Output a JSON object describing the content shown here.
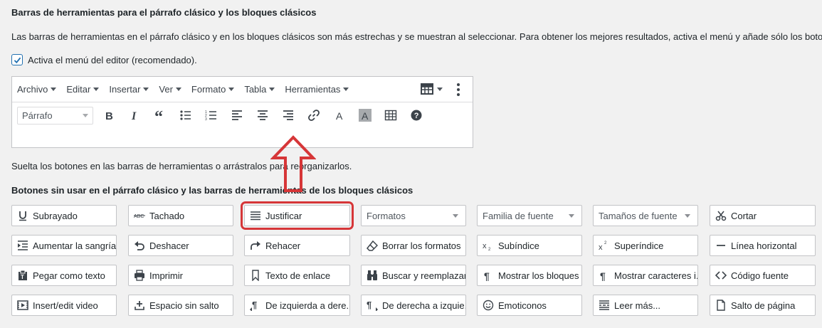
{
  "section": {
    "heading": "Barras de herramientas para el párrafo clásico y los bloques clásicos",
    "description": "Las barras de herramientas en el párrafo clásico y en los bloques clásicos son más estrechas y se muestran al seleccionar. Para obtener los mejores resultados, activa el menú y añade sólo los botones e",
    "checkbox_label": "Activa el menú del editor (recomendado).",
    "checkbox_checked": true
  },
  "editor": {
    "menu": [
      "Archivo",
      "Editar",
      "Insertar",
      "Ver",
      "Formato",
      "Tabla",
      "Herramientas"
    ],
    "format_select": "Párrafo",
    "toolbar_icons": [
      "bold-icon",
      "italic-icon",
      "blockquote-icon",
      "bullet-list-icon",
      "numbered-list-icon",
      "align-left-icon",
      "align-center-icon",
      "align-right-icon",
      "link-icon",
      "text-color-icon",
      "background-color-icon",
      "table-icon",
      "help-icon"
    ]
  },
  "drop_help": "Suelta los botones en las barras de herramientas o arrástralos para reorganizarlos.",
  "unused_heading": "Botones sin usar en el párrafo clásico y las barras de herramientas de los bloques clásicos",
  "buttons": [
    {
      "label": "Subrayado",
      "icon": "underline-icon"
    },
    {
      "label": "Tachado",
      "icon": "strikethrough-icon"
    },
    {
      "label": "Justificar",
      "icon": "justify-icon"
    },
    {
      "label": "Formatos",
      "icon": "select"
    },
    {
      "label": "Familia de fuente",
      "icon": "select"
    },
    {
      "label": "Tamaños de fuente",
      "icon": "select"
    },
    {
      "label": "Cortar",
      "icon": "scissors-icon"
    },
    {
      "label": "Aumentar la sangría",
      "icon": "indent-icon"
    },
    {
      "label": "Deshacer",
      "icon": "undo-icon"
    },
    {
      "label": "Rehacer",
      "icon": "redo-icon"
    },
    {
      "label": "Borrar los formatos",
      "icon": "eraser-icon"
    },
    {
      "label": "Subíndice",
      "icon": "subscript-icon"
    },
    {
      "label": "Superíndice",
      "icon": "superscript-icon"
    },
    {
      "label": "Línea horizontal",
      "icon": "horizontal-line-icon"
    },
    {
      "label": "Pegar como texto",
      "icon": "paste-text-icon"
    },
    {
      "label": "Imprimir",
      "icon": "print-icon"
    },
    {
      "label": "Texto de enlace",
      "icon": "bookmark-icon"
    },
    {
      "label": "Buscar y reemplazar",
      "icon": "binoculars-icon"
    },
    {
      "label": "Mostrar los bloques",
      "icon": "pilcrow-icon"
    },
    {
      "label": "Mostrar caracteres i...",
      "icon": "pilcrow-icon"
    },
    {
      "label": "Código fuente",
      "icon": "code-icon"
    },
    {
      "label": "Insert/edit video",
      "icon": "video-icon"
    },
    {
      "label": "Espacio sin salto",
      "icon": "nbsp-icon"
    },
    {
      "label": "De izquierda a dere...",
      "icon": "ltr-icon"
    },
    {
      "label": "De derecha a izquie...",
      "icon": "rtl-icon"
    },
    {
      "label": "Emoticonos",
      "icon": "smiley-icon"
    },
    {
      "label": "Leer más...",
      "icon": "read-more-icon"
    },
    {
      "label": "Salto de página",
      "icon": "page-break-icon"
    }
  ],
  "highlight_color": "#d63638",
  "accent_color": "#2271b1"
}
